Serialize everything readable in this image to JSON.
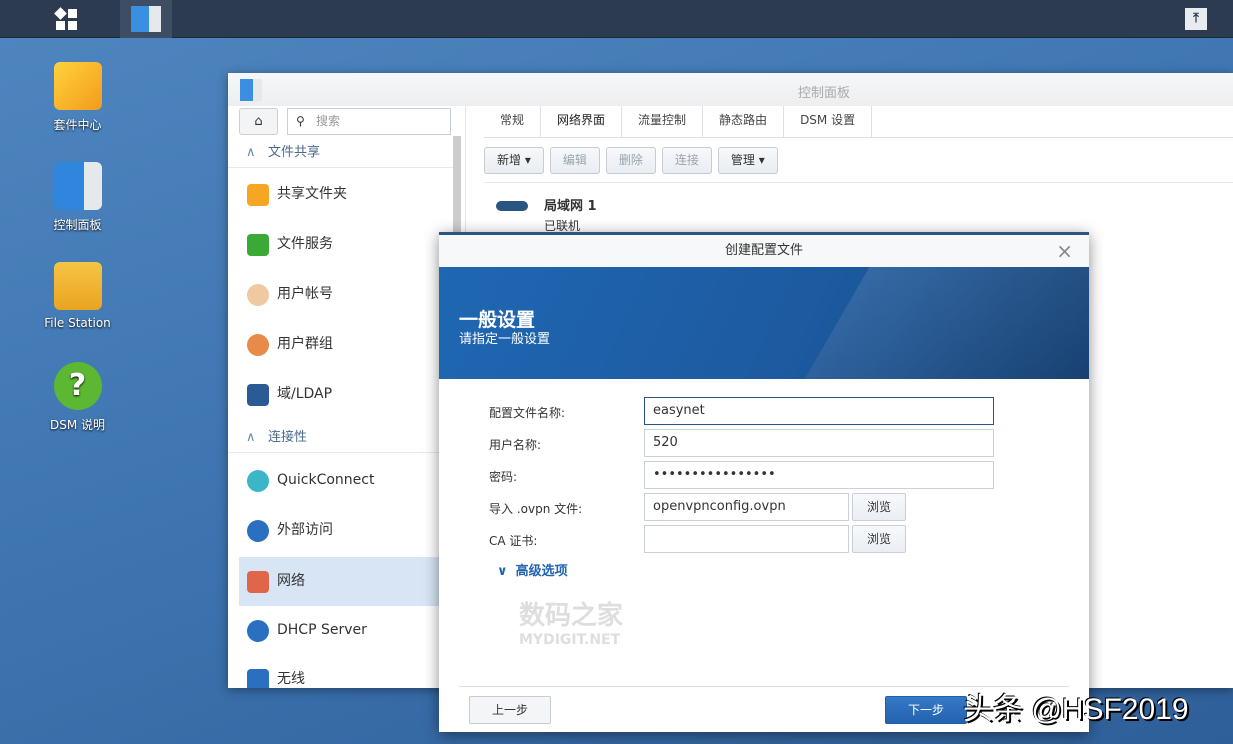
{
  "taskbar": {
    "apps": [
      "main-menu",
      "control-panel"
    ]
  },
  "desktop": {
    "icons": [
      {
        "label": "套件中心"
      },
      {
        "label": "控制面板"
      },
      {
        "label": "File Station"
      },
      {
        "label": "DSM 说明"
      }
    ]
  },
  "window": {
    "title": "控制面板",
    "search_placeholder": "搜索",
    "sections": {
      "file_sharing": "文件共享",
      "connectivity": "连接性"
    },
    "sidebar": [
      {
        "label": "共享文件夹"
      },
      {
        "label": "文件服务"
      },
      {
        "label": "用户帐号"
      },
      {
        "label": "用户群组"
      },
      {
        "label": "域/LDAP"
      },
      {
        "label": "QuickConnect"
      },
      {
        "label": "外部访问"
      },
      {
        "label": "网络",
        "selected": true
      },
      {
        "label": "DHCP Server"
      },
      {
        "label": "无线"
      }
    ],
    "tabs": [
      {
        "label": "常规"
      },
      {
        "label": "网络界面",
        "active": true
      },
      {
        "label": "流量控制"
      },
      {
        "label": "静态路由"
      },
      {
        "label": "DSM 设置"
      }
    ],
    "toolbar": {
      "add": "新增",
      "edit": "编辑",
      "delete": "删除",
      "connect": "连接",
      "manage": "管理"
    },
    "interfaces": [
      {
        "name": "局域网 1",
        "status": "已联机"
      }
    ]
  },
  "dialog": {
    "title": "创建配置文件",
    "heading": "一般设置",
    "subheading": "请指定一般设置",
    "fields": {
      "profile_label": "配置文件名称:",
      "profile_value": "easynet",
      "user_label": "用户名称:",
      "user_value": "520",
      "password_label": "密码:",
      "password_value": "••••••••••••••••",
      "ovpn_label": "导入 .ovpn 文件:",
      "ovpn_value": "openvpnconfig.ovpn",
      "ca_label": "CA 证书:",
      "ca_value": "",
      "browse": "浏览"
    },
    "advanced": "高级选项",
    "back": "上一步",
    "next": "下一步"
  },
  "watermark": {
    "cn": "数码之家",
    "en": "MYDIGIT.NET"
  },
  "overlay_text": "头条 @HSF2019",
  "colors": {
    "accent": "#2462ae",
    "taskbar": "#2c3b50",
    "selected": "#d7e5f5"
  }
}
